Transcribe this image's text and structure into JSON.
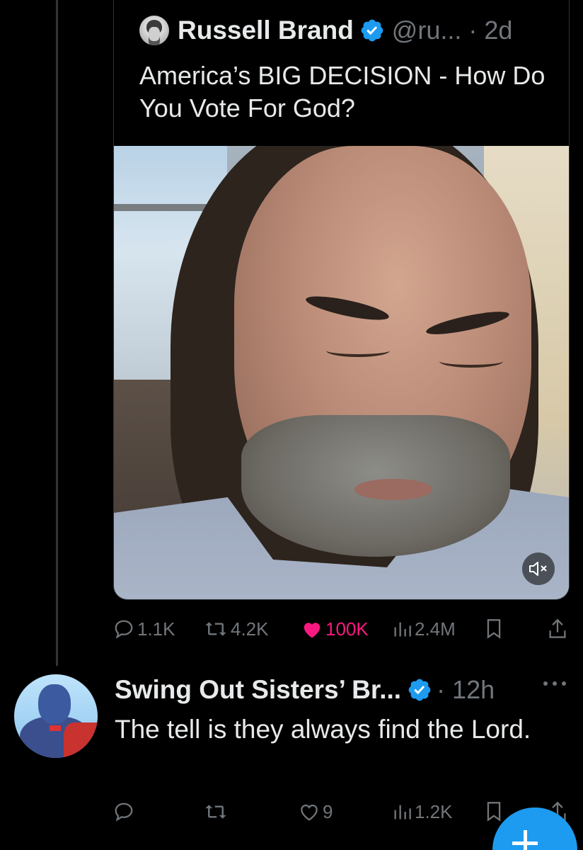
{
  "quoted_tweet": {
    "author_name": "Russell Brand",
    "handle_time": "@ru... · 2d",
    "text": "America’s BIG DECISION - How Do You Vote For God?",
    "media": {
      "icon": "mute-icon"
    },
    "metrics": {
      "replies": "1.1K",
      "reposts": "4.2K",
      "likes": "100K",
      "views": "2.4M"
    }
  },
  "reply_tweet": {
    "author_name": "Swing Out Sisters’ Br...",
    "time": "· 12h",
    "text": "The tell is they always find the Lord.",
    "metrics": {
      "replies": "",
      "reposts": "",
      "likes": "9",
      "views": "1.2K"
    }
  },
  "colors": {
    "background": "#000000",
    "text": "#e7e9ea",
    "muted": "#71767b",
    "verified": "#1d9bf0",
    "like_active": "#f91880",
    "fab": "#1d9bf0"
  }
}
